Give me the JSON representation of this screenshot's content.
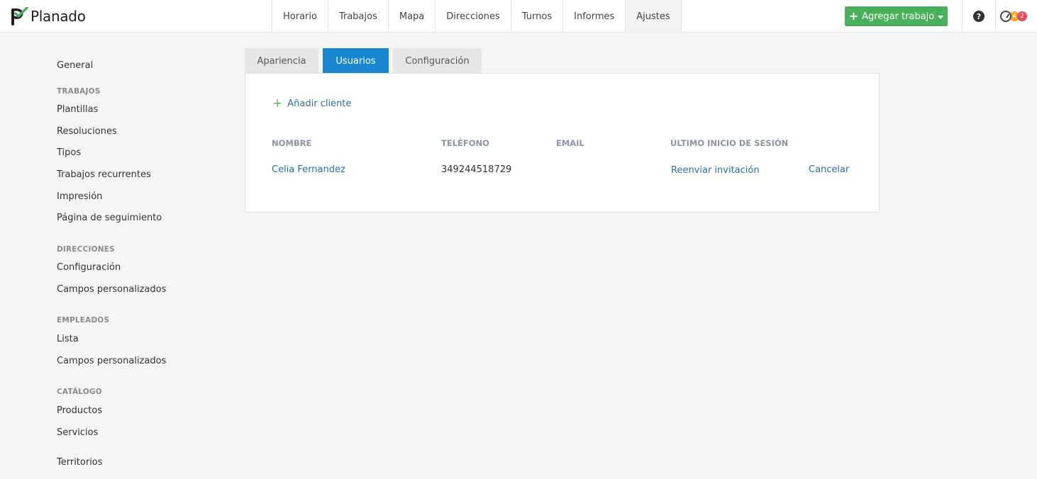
{
  "app": {
    "logo_text": "Planado",
    "brand_color": "#4caf5c"
  },
  "nav": {
    "items": [
      "Horario",
      "Trabajos",
      "Mapa",
      "Direcciones",
      "Turnos",
      "Informes",
      "Ajustes"
    ],
    "active": "Ajustes"
  },
  "header": {
    "add_job_label": "Agregar trabajo",
    "help_icon_text": "?",
    "badge_orange": "4",
    "badge_red": "2"
  },
  "sidebar": {
    "general": "General",
    "sections": [
      {
        "heading": "TRABAJOS",
        "items": [
          "Plantillas",
          "Resoluciones",
          "Tipos",
          "Trabajos recurrentes",
          "Impresión",
          "Página de seguimiento"
        ]
      },
      {
        "heading": "DIRECCIONES",
        "items": [
          "Configuración",
          "Campos personalizados"
        ]
      },
      {
        "heading": "EMPLEADOS",
        "items": [
          "Lista",
          "Campos personalizados"
        ]
      },
      {
        "heading": "CATÁLOGO",
        "items": [
          "Productos",
          "Servicios"
        ]
      }
    ],
    "territories": "Territorios"
  },
  "tabs": [
    {
      "label": "Apariencia",
      "active": false
    },
    {
      "label": "Usuarios",
      "active": true
    },
    {
      "label": "Configuración",
      "active": false
    }
  ],
  "users_panel": {
    "add_client_label": "Añadir cliente",
    "columns": [
      "NOMBRE",
      "TELÉFONO",
      "EMAIL",
      "ÚLTIMO INICIO DE SESIÓN"
    ],
    "rows": [
      {
        "name": "Celia Fernandez",
        "phone": "349244518729",
        "email": "",
        "resend": "Reenviar invitación",
        "cancel": "Cancelar"
      }
    ]
  }
}
